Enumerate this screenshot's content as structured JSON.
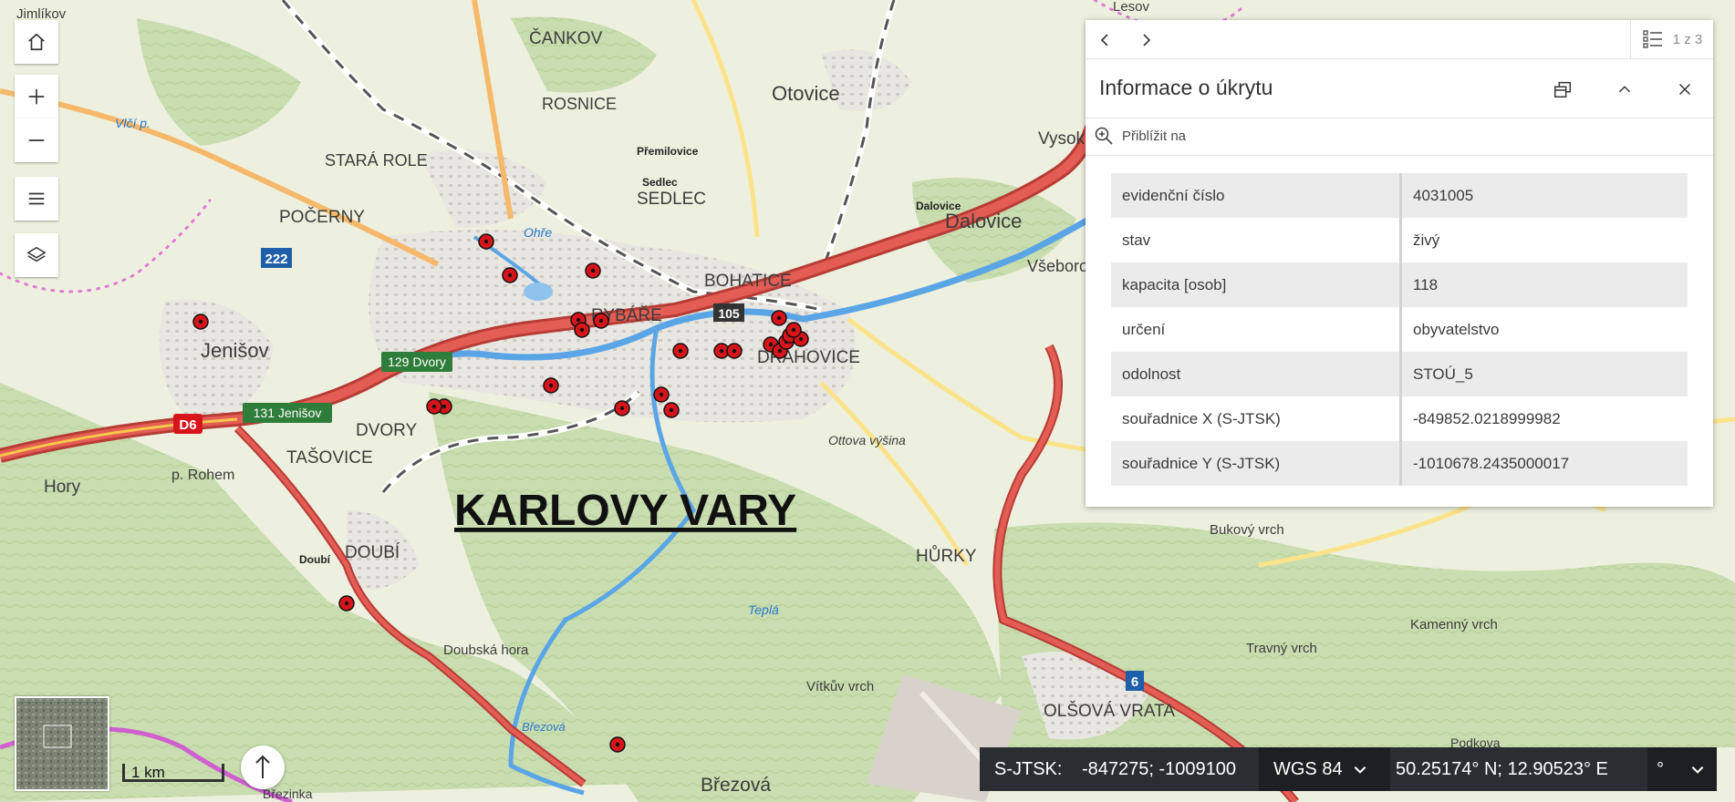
{
  "toolbar": {
    "home": "home-icon",
    "zoom_in": "plus-icon",
    "zoom_out": "minus-icon",
    "legend": "hamburger-icon",
    "layers": "layers-icon"
  },
  "map": {
    "city_title": "KARLOVY VARY",
    "places": [
      "Jimlíkov",
      "ČANKOV",
      "ROSNICE",
      "Otovice",
      "Vysoká",
      "STARÁ ROLE",
      "Přemilovice",
      "Sedlec",
      "SEDLEC",
      "POČERNY",
      "Dalovice",
      "BOHATICE",
      "Všeborovice",
      "RYBÁŘE",
      "DRAHOVICE",
      "Jenišov",
      "DVORY",
      "TAŠOVICE",
      "Hory",
      "p. Rohem",
      "Ottova výšina",
      "DOUBÍ",
      "HŮRKY",
      "Bukový vrch",
      "Doubská hora",
      "Travný vrch",
      "Kamenný vrch",
      "Vítkův vrch",
      "OLŠOVÁ VRATA",
      "Březová",
      "Březová",
      "Březinka",
      "Lesov",
      "Dalovice",
      "Doubí",
      "Teplá",
      "Ohře",
      "Vlčí p.",
      "Podkova"
    ],
    "road_labels": {
      "d6": "D6",
      "exit_129": "129 Dvory",
      "exit_131": "131 Jenišov",
      "route_222": "222",
      "route_105": "105",
      "route_6": "6"
    }
  },
  "popup": {
    "prev_icon": "chevron-left-icon",
    "next_icon": "chevron-right-icon",
    "count_icon": "list-icon",
    "count": "1 z 3",
    "title": "Informace o úkrytu",
    "dock_icon": "dock-icon",
    "collapse_icon": "chevron-up-icon",
    "close_icon": "close-icon",
    "zoom_label": "Přiblížit na",
    "attributes": [
      {
        "key": "evidenční číslo",
        "value": "4031005"
      },
      {
        "key": "stav",
        "value": "živý"
      },
      {
        "key": "kapacita [osob]",
        "value": "118"
      },
      {
        "key": "určení",
        "value": "obyvatelstvo"
      },
      {
        "key": "odolnost",
        "value": "STOÚ_5"
      },
      {
        "key": "souřadnice X (S-JTSK)",
        "value": "-849852.0218999982"
      },
      {
        "key": "souřadnice Y (S-JTSK)",
        "value": "-1010678.2435000017"
      }
    ]
  },
  "scalebar": {
    "label": "1 km"
  },
  "compass": {
    "icon": "north-arrow-icon"
  },
  "coordinates": {
    "system_label": "S-JTSK:",
    "system_value": "-847275; -1009100",
    "projection": "WGS 84",
    "latlon": "50.25174° N; 12.90523° E",
    "format": "°"
  },
  "colors": {
    "shelter_marker": "#d7141a",
    "highway": "#d9534f",
    "river": "#5aa5e6",
    "panel_dark": "#2a2d31"
  }
}
